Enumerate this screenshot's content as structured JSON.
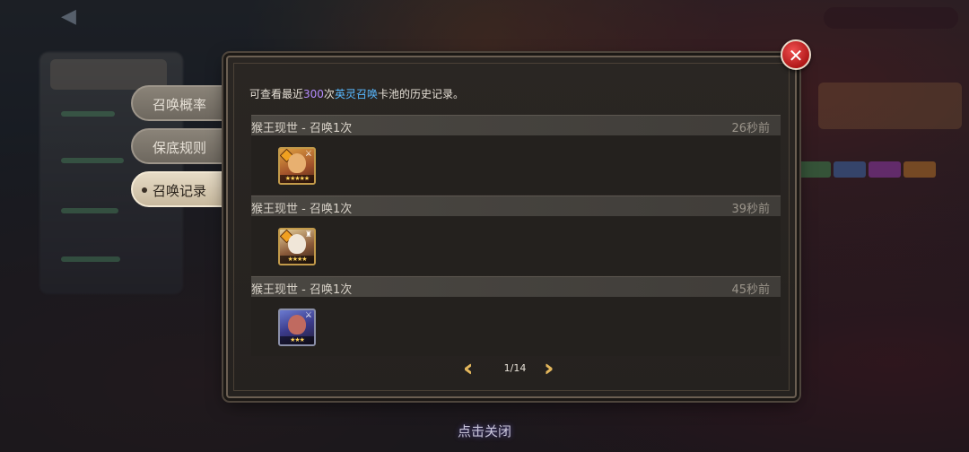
{
  "intro": {
    "prefix": "可查看最近",
    "count": "300",
    "mid": "次",
    "pool_name": "英灵召唤",
    "suffix": "卡池的历史记录。"
  },
  "tabs": [
    {
      "label": "召唤概率",
      "active": false
    },
    {
      "label": "保底规则",
      "active": false
    },
    {
      "label": "召唤记录",
      "active": true
    }
  ],
  "records": [
    {
      "title": "猴王现世 - 召唤1次",
      "time": "26秒前",
      "hero_icon": "monkey-king-hero-icon",
      "stars": "★★★★★"
    },
    {
      "title": "猴王现世 - 召唤1次",
      "time": "39秒前",
      "hero_icon": "white-haired-hero-icon",
      "stars": "★★★★"
    },
    {
      "title": "猴王现世 - 召唤1次",
      "time": "45秒前",
      "hero_icon": "red-haired-hero-icon",
      "stars": "★★★"
    }
  ],
  "pagination": {
    "current": "1/14",
    "prev_icon": "double-chevron-left-icon",
    "next_icon": "double-chevron-right-icon"
  },
  "close_icon": "close-x-icon",
  "tap_to_close": "点击关闭",
  "colors": {
    "count": "#b58cff",
    "pool": "#58b8ff",
    "star": "#ffd45a"
  }
}
